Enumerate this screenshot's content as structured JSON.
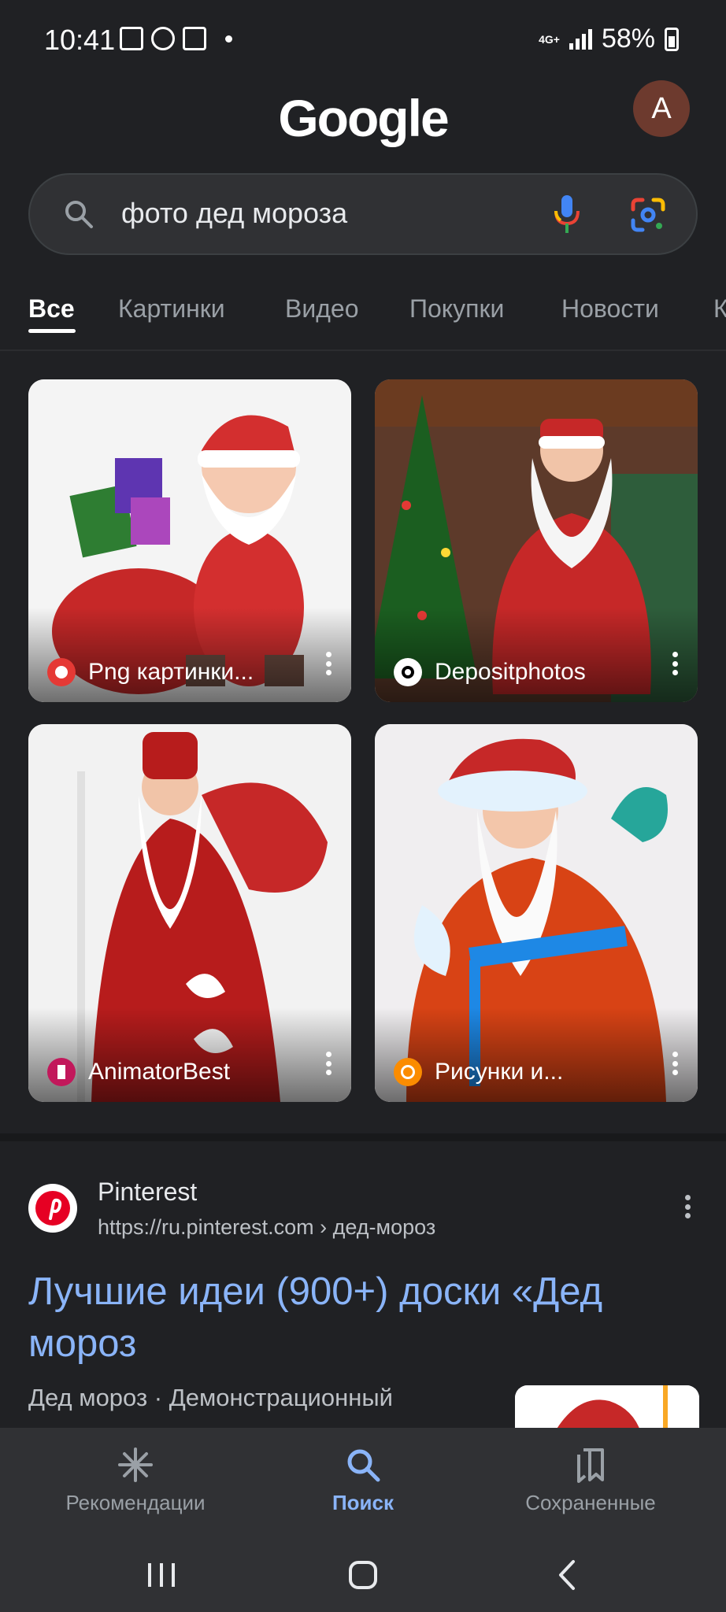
{
  "status_bar": {
    "time": "10:41",
    "network": "4G+",
    "battery": "58%"
  },
  "header": {
    "logo": "Google",
    "avatar_letter": "A"
  },
  "search": {
    "query": "фото дед мороза"
  },
  "tabs": [
    {
      "label": "Все",
      "active": true
    },
    {
      "label": "Картинки"
    },
    {
      "label": "Видео"
    },
    {
      "label": "Покупки"
    },
    {
      "label": "Новости"
    },
    {
      "label": "К"
    }
  ],
  "images": [
    {
      "source": "Png картинки...",
      "favicon_color": "#e53935"
    },
    {
      "source": "Depositphotos",
      "favicon_color": "#ffffff"
    },
    {
      "source": "AnimatorBest",
      "favicon_color": "#c2185b"
    },
    {
      "source": "Рисунки и...",
      "favicon_color": "#fb8c00"
    }
  ],
  "result": {
    "site": "Pinterest",
    "url": "https://ru.pinterest.com",
    "breadcrumb": " › дед-мороз",
    "title": "Лучшие идеи (900+) доски «Дед мороз",
    "snippet": "Дед мороз · Демонстрационный"
  },
  "bottom_nav": [
    {
      "label": "Рекомендации",
      "icon": "asterisk-icon"
    },
    {
      "label": "Поиск",
      "icon": "search-icon",
      "active": true
    },
    {
      "label": "Сохраненные",
      "icon": "bookmarks-icon"
    }
  ],
  "colors": {
    "background": "#202124",
    "link": "#8ab4f8",
    "active_nav": "#8ab4f8"
  }
}
